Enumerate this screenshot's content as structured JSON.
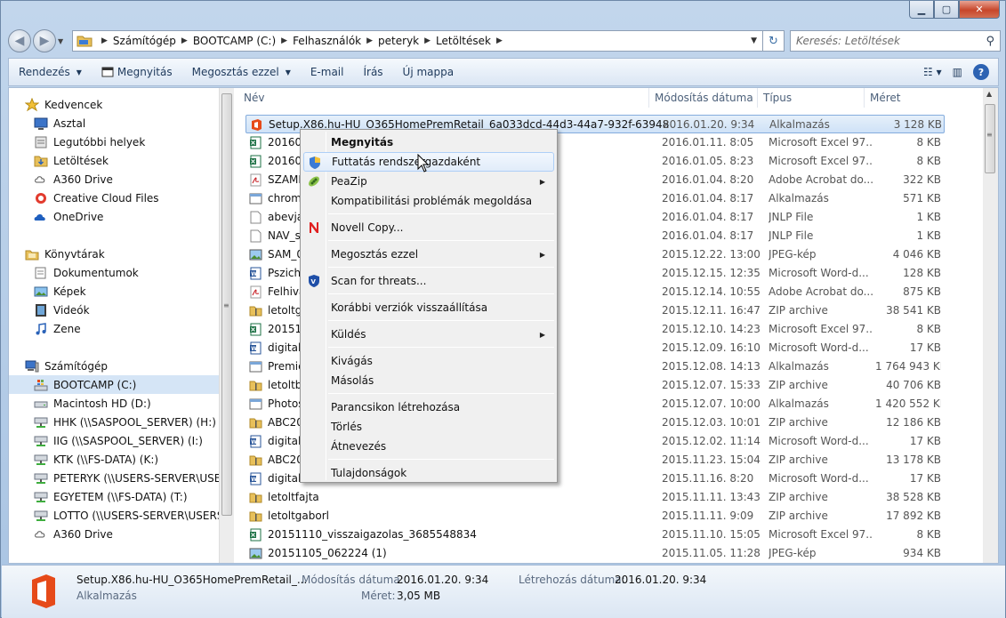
{
  "breadcrumb": [
    "Számítógép",
    "BOOTCAMP (C:)",
    "Felhasználók",
    "peteryk",
    "Letöltések"
  ],
  "search": {
    "placeholder": "Keresés: Letöltések"
  },
  "toolbar": {
    "organize": "Rendezés",
    "open": "Megnyitás",
    "share": "Megosztás ezzel",
    "email": "E-mail",
    "burn": "Írás",
    "new_folder": "Új mappa"
  },
  "sidebar": {
    "favorites_header": "Kedvencek",
    "favorites": [
      "Asztal",
      "Legutóbbi helyek",
      "Letöltések",
      "A360 Drive",
      "Creative Cloud Files",
      "OneDrive"
    ],
    "libraries_header": "Könyvtárak",
    "libraries": [
      "Dokumentumok",
      "Képek",
      "Videók",
      "Zene"
    ],
    "computer_header": "Számítógép",
    "drives": [
      "BOOTCAMP (C:)",
      "Macintosh HD (D:)",
      "HHK (\\\\SASPOOL_SERVER) (H:)",
      "IIG (\\\\SASPOOL_SERVER) (I:)",
      "KTK (\\\\FS-DATA) (K:)",
      "PETERYK (\\\\USERS-SERVER\\USERS\\",
      "EGYETEM (\\\\FS-DATA) (T:)",
      "LOTTO (\\\\USERS-SERVER\\USERS\\H",
      "A360 Drive"
    ]
  },
  "columns": {
    "name": "Név",
    "date": "Módosítás dátuma",
    "type": "Típus",
    "size": "Méret"
  },
  "files": [
    {
      "name": "Setup.X86.hu-HU_O365HomePremRetail_6a033dcd-44d3-44a7-932f-63948b2bd...",
      "date": "2016.01.20. 9:34",
      "type": "Alkalmazás",
      "size": "3 128 KB",
      "icon": "office"
    },
    {
      "name": "201601",
      "date": "2016.01.11. 8:05",
      "type": "Microsoft Excel 97...",
      "size": "8 KB",
      "icon": "excel"
    },
    {
      "name": "201601",
      "date": "2016.01.05. 8:23",
      "type": "Microsoft Excel 97...",
      "size": "8 KB",
      "icon": "excel"
    },
    {
      "name": "SZAML",
      "date": "2016.01.04. 8:20",
      "type": "Adobe Acrobat do...",
      "size": "322 KB",
      "icon": "pdf"
    },
    {
      "name": "chrom",
      "date": "2016.01.04. 8:17",
      "type": "Alkalmazás",
      "size": "571 KB",
      "icon": "app"
    },
    {
      "name": "abevjav",
      "date": "2016.01.04. 8:17",
      "type": "JNLP File",
      "size": "1 KB",
      "icon": "file"
    },
    {
      "name": "NAV_sz",
      "date": "2016.01.04. 8:17",
      "type": "JNLP File",
      "size": "1 KB",
      "icon": "file"
    },
    {
      "name": "SAM_0",
      "date": "2015.12.22. 13:00",
      "type": "JPEG-kép",
      "size": "4 046 KB",
      "icon": "image"
    },
    {
      "name": "Pszicho",
      "date": "2015.12.15. 12:35",
      "type": "Microsoft Word-d...",
      "size": "128 KB",
      "icon": "word"
    },
    {
      "name": "Felhiva",
      "date": "2015.12.14. 10:55",
      "type": "Adobe Acrobat do...",
      "size": "875 KB",
      "icon": "pdf"
    },
    {
      "name": "letoltga",
      "date": "2015.12.11. 16:47",
      "type": "ZIP archive",
      "size": "38 541 KB",
      "icon": "zip"
    },
    {
      "name": "201512",
      "date": "2015.12.10. 14:23",
      "type": "Microsoft Excel 97...",
      "size": "8 KB",
      "icon": "excel"
    },
    {
      "name": "digitali",
      "date": "2015.12.09. 16:10",
      "type": "Microsoft Word-d...",
      "size": "17 KB",
      "icon": "word"
    },
    {
      "name": "Premie",
      "date": "2015.12.08. 14:13",
      "type": "Alkalmazás",
      "size": "1 764 943 KB",
      "icon": "app"
    },
    {
      "name": "letoltbe",
      "date": "2015.12.07. 15:33",
      "type": "ZIP archive",
      "size": "40 706 KB",
      "icon": "zip"
    },
    {
      "name": "Photos",
      "date": "2015.12.07. 10:00",
      "type": "Alkalmazás",
      "size": "1 420 552 KB",
      "icon": "app"
    },
    {
      "name": "ABC201",
      "date": "2015.12.03. 10:01",
      "type": "ZIP archive",
      "size": "12 186 KB",
      "icon": "zip"
    },
    {
      "name": "digitali",
      "date": "2015.12.02. 11:14",
      "type": "Microsoft Word-d...",
      "size": "17 KB",
      "icon": "word"
    },
    {
      "name": "ABC201",
      "date": "2015.11.23. 15:04",
      "type": "ZIP archive",
      "size": "13 178 KB",
      "icon": "zip"
    },
    {
      "name": "digitali",
      "date": "2015.11.16. 8:20",
      "type": "Microsoft Word-d...",
      "size": "17 KB",
      "icon": "word"
    },
    {
      "name": "letoltfajta",
      "date": "2015.11.11. 13:43",
      "type": "ZIP archive",
      "size": "38 528 KB",
      "icon": "zip"
    },
    {
      "name": "letoltgaborl",
      "date": "2015.11.11. 9:09",
      "type": "ZIP archive",
      "size": "17 892 KB",
      "icon": "zip"
    },
    {
      "name": "20151110_visszaigazolas_3685548834",
      "date": "2015.11.10. 15:05",
      "type": "Microsoft Excel 97...",
      "size": "8 KB",
      "icon": "excel"
    },
    {
      "name": "20151105_062224 (1)",
      "date": "2015.11.05. 11:28",
      "type": "JPEG-kép",
      "size": "934 KB",
      "icon": "image"
    }
  ],
  "context_menu": [
    {
      "label": "Megnyitás",
      "bold": true
    },
    {
      "label": "Futtatás rendszergazdaként",
      "icon": "shield",
      "hover": true
    },
    {
      "label": "PeaZip",
      "icon": "peazip",
      "submenu": true
    },
    {
      "label": "Kompatibilitási problémák megoldása"
    },
    {
      "sep": true
    },
    {
      "label": "Novell Copy...",
      "icon": "novell"
    },
    {
      "sep": true
    },
    {
      "label": "Megosztás ezzel",
      "submenu": true
    },
    {
      "sep": true
    },
    {
      "label": "Scan for threats...",
      "icon": "scan"
    },
    {
      "sep": true
    },
    {
      "label": "Korábbi verziók visszaállítása"
    },
    {
      "sep": true
    },
    {
      "label": "Küldés",
      "submenu": true
    },
    {
      "sep": true
    },
    {
      "label": "Kivágás"
    },
    {
      "label": "Másolás"
    },
    {
      "sep": true
    },
    {
      "label": "Parancsikon létrehozása"
    },
    {
      "label": "Törlés"
    },
    {
      "label": "Átnevezés"
    },
    {
      "sep": true
    },
    {
      "label": "Tulajdonságok"
    }
  ],
  "details": {
    "name": "Setup.X86.hu-HU_O365HomePremRetail_...",
    "type": "Alkalmazás",
    "modified_label": "Módosítás dátuma:",
    "modified_value": "2016.01.20. 9:34",
    "created_label": "Létrehozás dátuma:",
    "created_value": "2016.01.20. 9:34",
    "size_label": "Méret:",
    "size_value": "3,05 MB"
  }
}
